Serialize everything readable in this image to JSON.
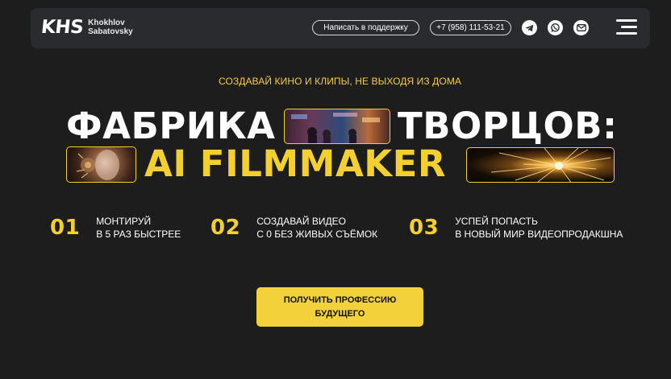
{
  "header": {
    "logo_mark": "KHS",
    "logo_line1": "Khokhlov",
    "logo_line2": "Sabatovsky",
    "support_label": "Написать в поддержку",
    "phone": "+7 (958) 111-53-21",
    "social_icons": [
      "telegram-icon",
      "whatsapp-icon",
      "mail-icon"
    ],
    "menu_icon": "burger-menu-icon"
  },
  "hero": {
    "tagline": "СОЗДАВАЙ КИНО И КЛИПЫ, НЕ ВЫХОДЯ ИЗ ДОМА",
    "title_word1": "ФАБРИКА",
    "title_word2": "ТВОРЦОВ:",
    "title_line2": "AI FILMMAKER"
  },
  "features": [
    {
      "num": "01",
      "line1": "МОНТИРУЙ",
      "line2": "В 5 РАЗ БЫСТРЕЕ"
    },
    {
      "num": "02",
      "line1": "СОЗДАВАЙ ВИДЕО",
      "line2": "С 0 БЕЗ ЖИВЫХ СЪЁМОК"
    },
    {
      "num": "03",
      "line1": "УСПЕЙ ПОПАСТЬ",
      "line2": "В НОВЫЙ МИР ВИДЕОПРОДАКШНА"
    }
  ],
  "cta": {
    "line1": "ПОЛУЧИТЬ ПРОФЕССИЮ",
    "line2": "БУДУЩЕГО"
  },
  "colors": {
    "background": "#1d1d1d",
    "header_bg": "#2a2b2f",
    "accent": "#f3cf2f",
    "text": "#ffffff"
  }
}
